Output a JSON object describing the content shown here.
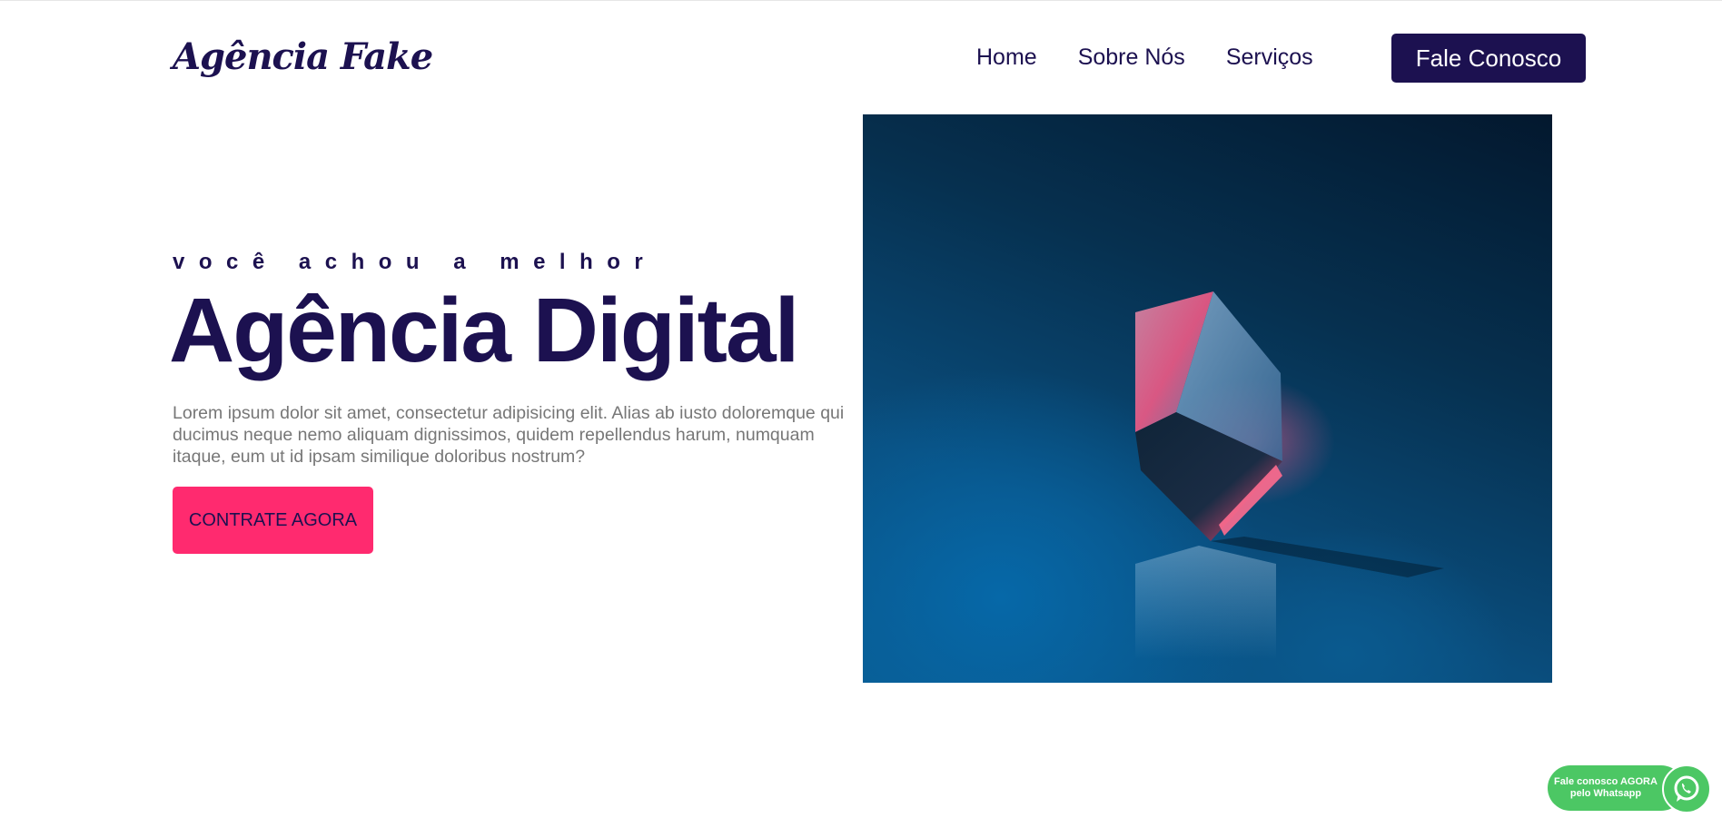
{
  "header": {
    "logo": "Agência Fake",
    "nav": [
      {
        "label": "Home"
      },
      {
        "label": "Sobre Nós"
      },
      {
        "label": "Serviços"
      }
    ],
    "cta_label": "Fale Conosco"
  },
  "hero": {
    "eyebrow": "você achou a melhor",
    "title": "Agência Digital",
    "text": "Lorem ipsum dolor sit amet, consectetur adipisicing elit. Alias ab iusto doloremque qui ducimus neque nemo aliquam dignissimos, quidem repellendus harum, numquam itaque, eum ut id ipsam similique doloribus nostrum?",
    "cta_label": "CONTRATE AGORA"
  },
  "whatsapp": {
    "line1": "Fale conosco AGORA",
    "line2": "pelo Whatsapp",
    "icon": "whatsapp-icon"
  },
  "colors": {
    "brand": "#1c1150",
    "accent": "#ff2a6f",
    "whatsapp": "#4cc764",
    "body_text": "#777777"
  }
}
